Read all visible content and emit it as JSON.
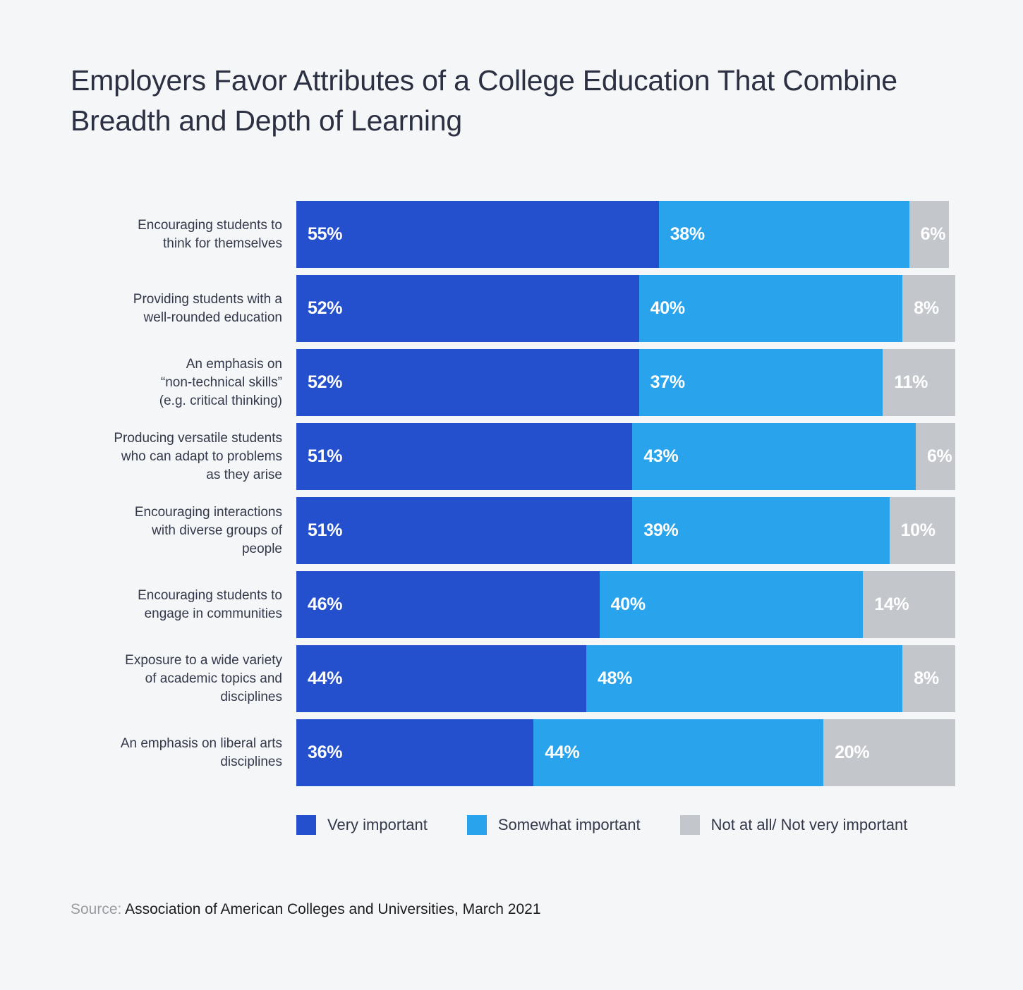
{
  "title": "Employers Favor Attributes of a College Education That Combine Breadth and Depth of Learning",
  "source": {
    "label": "Source:",
    "value": "Association of American Colleges and Universities, March 2021"
  },
  "legend": [
    {
      "label": "Very important",
      "color": "#2450ce"
    },
    {
      "label": "Somewhat important",
      "color": "#29a3ec"
    },
    {
      "label": "Not at all/ Not very important",
      "color": "#c3c6cb"
    }
  ],
  "chart_data": {
    "type": "bar",
    "orientation": "horizontal",
    "stacked": true,
    "percent_stacked": true,
    "title": "Employers Favor Attributes of a College Education That Combine Breadth and Depth of Learning",
    "xlabel": "",
    "ylabel": "",
    "xlim": [
      0,
      100
    ],
    "grid": false,
    "legend_position": "bottom",
    "value_suffix": "%",
    "categories": [
      "Encouraging students to think for themselves",
      "Providing students with a well-rounded education",
      "An emphasis on “non-technical skills” (e.g. critical thinking)",
      "Producing versatile students who can adapt to problems as they arise",
      "Encouraging interactions with diverse groups of people",
      "Encouraging students to engage in communities",
      "Exposure to a wide variety of academic topics and disciplines",
      "An emphasis on liberal arts disciplines"
    ],
    "category_lines": [
      [
        "Encouraging students to",
        "think for themselves"
      ],
      [
        "Providing students with a",
        "well-rounded education"
      ],
      [
        "An emphasis on",
        "“non-technical skills”",
        "(e.g. critical thinking)"
      ],
      [
        "Producing versatile students",
        "who can adapt to problems",
        "as they arise"
      ],
      [
        "Encouraging interactions",
        "with diverse groups of",
        "people"
      ],
      [
        "Encouraging students to",
        "engage in communities"
      ],
      [
        "Exposure to a wide variety",
        "of academic topics and",
        "disciplines"
      ],
      [
        "An emphasis on liberal arts",
        "disciplines"
      ]
    ],
    "series": [
      {
        "name": "Very important",
        "color": "#2450ce",
        "values": [
          55,
          52,
          52,
          51,
          51,
          46,
          44,
          36
        ],
        "labels": [
          "55%",
          "52%",
          "52%",
          "51%",
          "51%",
          "46%",
          "44%",
          "36%"
        ]
      },
      {
        "name": "Somewhat important",
        "color": "#29a3ec",
        "values": [
          38,
          40,
          37,
          43,
          39,
          40,
          48,
          44
        ],
        "labels": [
          "38%",
          "40%",
          "37%",
          "43%",
          "39%",
          "40%",
          "48%",
          "44%"
        ]
      },
      {
        "name": "Not at all/ Not very important",
        "color": "#c3c6cb",
        "values": [
          6,
          8,
          11,
          6,
          10,
          14,
          8,
          20
        ],
        "labels": [
          "6%",
          "8%",
          "11%",
          "6%",
          "10%",
          "14%",
          "8%",
          "20%"
        ]
      }
    ]
  }
}
